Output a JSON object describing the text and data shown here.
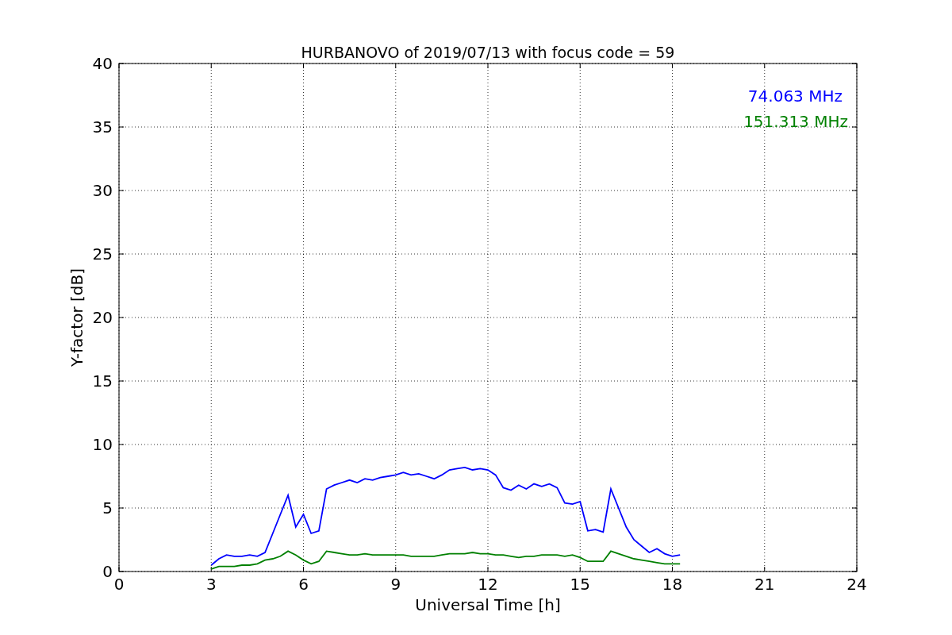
{
  "chart_data": {
    "type": "line",
    "title": "HURBANOVO of 2019/07/13 with focus code = 59",
    "xlabel": "Universal Time [h]",
    "ylabel": "Y-factor [dB]",
    "x": [
      3.0,
      3.25,
      3.5,
      3.75,
      4.0,
      4.25,
      4.5,
      4.75,
      5.0,
      5.25,
      5.5,
      5.75,
      6.0,
      6.25,
      6.5,
      6.75,
      7.0,
      7.25,
      7.5,
      7.75,
      8.0,
      8.25,
      8.5,
      8.75,
      9.0,
      9.25,
      9.5,
      9.75,
      10.0,
      10.25,
      10.5,
      10.75,
      11.0,
      11.25,
      11.5,
      11.75,
      12.0,
      12.25,
      12.5,
      12.75,
      13.0,
      13.25,
      13.5,
      13.75,
      14.0,
      14.25,
      14.5,
      14.75,
      15.0,
      15.25,
      15.5,
      15.75,
      16.0,
      16.25,
      16.5,
      16.75,
      17.0,
      17.25,
      17.5,
      17.75,
      18.0,
      18.25
    ],
    "series": [
      {
        "name": "74.063 MHz",
        "color": "#0000ff",
        "values": [
          0.5,
          1.0,
          1.3,
          1.2,
          1.2,
          1.3,
          1.2,
          1.5,
          3.0,
          4.5,
          6.0,
          3.5,
          4.5,
          3.0,
          3.2,
          6.5,
          6.8,
          7.0,
          7.2,
          7.0,
          7.3,
          7.2,
          7.4,
          7.5,
          7.6,
          7.8,
          7.6,
          7.7,
          7.5,
          7.3,
          7.6,
          8.0,
          8.1,
          8.2,
          8.0,
          8.1,
          8.0,
          7.6,
          6.6,
          6.4,
          6.8,
          6.5,
          6.9,
          6.7,
          6.9,
          6.6,
          5.4,
          5.3,
          5.5,
          3.2,
          3.3,
          3.1,
          6.5,
          5.0,
          3.5,
          2.5,
          2.0,
          1.5,
          1.8,
          1.4,
          1.2,
          1.3
        ]
      },
      {
        "name": "151.313 MHz",
        "color": "#008000",
        "values": [
          0.2,
          0.4,
          0.4,
          0.4,
          0.5,
          0.5,
          0.6,
          0.9,
          1.0,
          1.2,
          1.6,
          1.3,
          0.9,
          0.6,
          0.8,
          1.6,
          1.5,
          1.4,
          1.3,
          1.3,
          1.4,
          1.3,
          1.3,
          1.3,
          1.3,
          1.3,
          1.2,
          1.2,
          1.2,
          1.2,
          1.3,
          1.4,
          1.4,
          1.4,
          1.5,
          1.4,
          1.4,
          1.3,
          1.3,
          1.2,
          1.1,
          1.2,
          1.2,
          1.3,
          1.3,
          1.3,
          1.2,
          1.3,
          1.1,
          0.8,
          0.8,
          0.8,
          1.6,
          1.4,
          1.2,
          1.0,
          0.9,
          0.8,
          0.7,
          0.6,
          0.6,
          0.6
        ]
      }
    ],
    "grid": true,
    "xlim": [
      0,
      24
    ],
    "ylim": [
      0,
      40
    ],
    "xticks": [
      0,
      3,
      6,
      9,
      12,
      15,
      18,
      21,
      24
    ],
    "yticks": [
      0,
      5,
      10,
      15,
      20,
      25,
      30,
      35,
      40
    ]
  }
}
